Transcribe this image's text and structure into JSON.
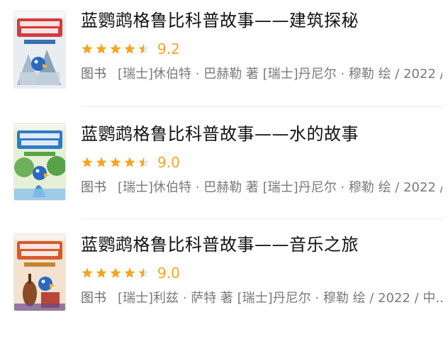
{
  "books": [
    {
      "title": "蓝鹦鹉格鲁比科普故事——建筑探秘",
      "rating_value": 9.2,
      "rating_text": "9.2",
      "rating_stars": 4.5,
      "tag": "图书",
      "meta": "[瑞士]休伯特 · 巴赫勒 著 [瑞士]丹尼尔 · 穆勒 绘 / 2022 /...",
      "cover_colors": {
        "bg": "#e8edf2",
        "band": "#d23b3b",
        "accent": "#3a6fb0"
      }
    },
    {
      "title": "蓝鹦鹉格鲁比科普故事——水的故事",
      "rating_value": 9.0,
      "rating_text": "9.0",
      "rating_stars": 4.5,
      "tag": "图书",
      "meta": "[瑞士]休伯特 · 巴赫勒 著 [瑞士]丹尼尔 · 穆勒 绘 / 2022 /...",
      "cover_colors": {
        "bg": "#e6f0d6",
        "band": "#2f7bc6",
        "accent": "#58a34a"
      }
    },
    {
      "title": "蓝鹦鹉格鲁比科普故事——音乐之旅",
      "rating_value": 9.0,
      "rating_text": "9.0",
      "rating_stars": 4.5,
      "tag": "图书",
      "meta": "[瑞士]利兹 · 萨特 著 [瑞士]丹尼尔 · 穆勒 绘 / 2022 / 中...",
      "cover_colors": {
        "bg": "#f3e2cf",
        "band": "#d65a2e",
        "accent": "#c2872c"
      }
    }
  ],
  "colors": {
    "star": "#f4a524",
    "star_empty": "#e6e6e6",
    "meta_text": "#7a7a7a",
    "divider": "#ebebeb"
  },
  "icons": {
    "star_full": "star-full-icon",
    "star_half": "star-half-icon"
  }
}
